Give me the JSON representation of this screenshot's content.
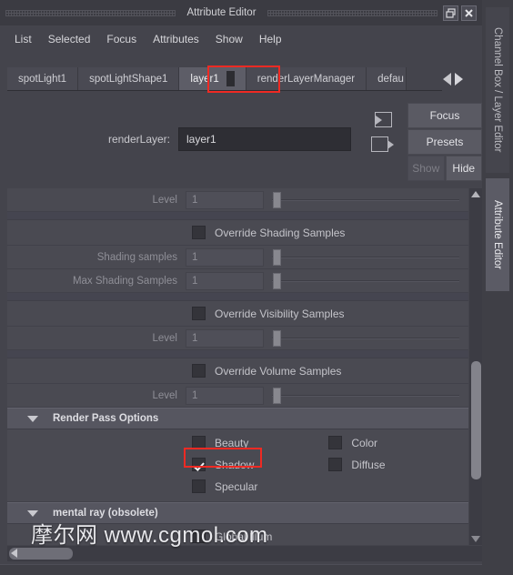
{
  "window": {
    "title": "Attribute Editor",
    "restore_icon": "restore-icon",
    "close_icon": "close-icon"
  },
  "menubar": {
    "items": [
      {
        "label": "List"
      },
      {
        "label": "Selected"
      },
      {
        "label": "Focus"
      },
      {
        "label": "Attributes"
      },
      {
        "label": "Show"
      },
      {
        "label": "Help"
      }
    ]
  },
  "node_tabs": {
    "items": [
      {
        "label": "spotLight1",
        "active": false
      },
      {
        "label": "spotLightShape1",
        "active": false
      },
      {
        "label": "layer1",
        "active": true
      },
      {
        "label": "renderLayerManager",
        "active": false
      },
      {
        "label": "defau",
        "active": false
      }
    ],
    "prev_icon": "arrow-left-icon",
    "next_icon": "arrow-right-icon",
    "highlight_color": "#ef2a23"
  },
  "render_layer": {
    "label": "renderLayer:",
    "value": "layer1",
    "input_connection_icon": "input-connection-icon",
    "output_connection_icon": "output-connection-icon"
  },
  "side_buttons": {
    "focus": "Focus",
    "presets": "Presets",
    "show": "Show",
    "hide": "Hide"
  },
  "attributes": {
    "rows": [
      {
        "type": "slider",
        "label": "Level",
        "value": "1"
      },
      {
        "type": "spacer"
      },
      {
        "type": "checkbox",
        "label": "Override Shading Samples",
        "checked": false
      },
      {
        "type": "slider",
        "label": "Shading samples",
        "value": "1"
      },
      {
        "type": "slider",
        "label": "Max Shading Samples",
        "value": "1"
      },
      {
        "type": "spacer"
      },
      {
        "type": "checkbox",
        "label": "Override Visibility Samples",
        "checked": false
      },
      {
        "type": "slider",
        "label": "Level",
        "value": "1"
      },
      {
        "type": "spacer"
      },
      {
        "type": "checkbox",
        "label": "Override Volume Samples",
        "checked": false
      },
      {
        "type": "slider",
        "label": "Level",
        "value": "1"
      }
    ],
    "render_pass_section": {
      "title": "Render Pass Options",
      "caret_icon": "caret-down-icon",
      "column_left": [
        {
          "label": "Beauty",
          "checked": false
        },
        {
          "label": "Shadow",
          "checked": true,
          "highlighted": true
        },
        {
          "label": "Specular",
          "checked": false
        }
      ],
      "column_right": [
        {
          "label": "Color",
          "checked": false
        },
        {
          "label": "Diffuse",
          "checked": false
        }
      ]
    },
    "mental_ray_section": {
      "title": "mental ray (obsolete)",
      "caret_icon": "caret-down-icon",
      "items": [
        {
          "label": "Global Illum",
          "checked": false
        }
      ]
    }
  },
  "scrollbars": {
    "vertical_up_icon": "scroll-up-arrow-icon",
    "vertical_down_icon": "scroll-down-arrow-icon",
    "horizontal_left_icon": "scroll-left-arrow-icon"
  },
  "vertical_tabs": {
    "channel_box": "Channel Box / Layer Editor",
    "attribute_editor": "Attribute Editor"
  },
  "watermark": {
    "text": "摩尔网 www.cgmol.com"
  }
}
